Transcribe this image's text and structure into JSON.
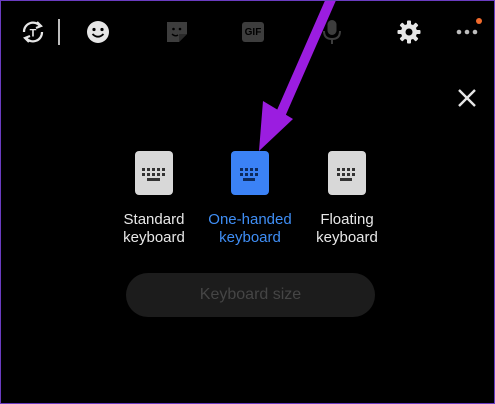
{
  "toolbar": {
    "icons": [
      "translate-icon",
      "emoji-icon",
      "sticker-icon",
      "gif-icon",
      "microphone-icon",
      "settings-icon",
      "more-icon"
    ],
    "gif_label": "GIF"
  },
  "options": [
    {
      "label_line1": "Standard",
      "label_line2": "keyboard",
      "selected": false
    },
    {
      "label_line1": "One-handed",
      "label_line2": "keyboard",
      "selected": true
    },
    {
      "label_line1": "Floating",
      "label_line2": "keyboard",
      "selected": false
    }
  ],
  "keyboard_size_label": "Keyboard size",
  "colors": {
    "accent": "#3f8ef5",
    "annotation_arrow": "#9b1de0",
    "background": "#000000",
    "notification_dot": "#f26b2d"
  }
}
